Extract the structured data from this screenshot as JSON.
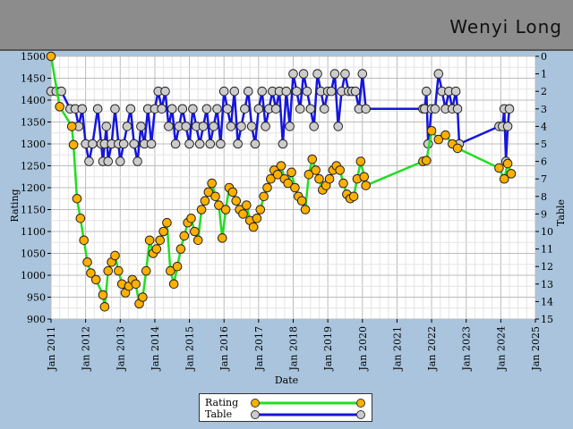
{
  "header": {
    "player_name": "Wenyi Long"
  },
  "legend": {
    "rating_label": "Rating",
    "table_label": "Table"
  },
  "chart_data": {
    "type": "line",
    "xlabel": "Date",
    "ylabel": "Rating",
    "y2label": "Table",
    "xlim": [
      2011.0,
      2025.0
    ],
    "ylim": [
      900,
      1500
    ],
    "y2lim": [
      0,
      15
    ],
    "y2_inverted": true,
    "grid": true,
    "legend_position": "bottom-center",
    "x_ticks": [
      "Jan 2011",
      "Jan 2012",
      "Jan 2013",
      "Jan 2014",
      "Jan 2015",
      "Jan 2016",
      "Jan 2017",
      "Jan 2018",
      "Jan 2019",
      "Jan 2020",
      "Jan 2021",
      "Jan 2022",
      "Jan 2023",
      "Jan 2024",
      "Jan 2025"
    ],
    "y_ticks": [
      900,
      950,
      1000,
      1050,
      1100,
      1150,
      1200,
      1250,
      1300,
      1350,
      1400,
      1450,
      1500
    ],
    "y2_ticks": [
      0,
      1,
      2,
      3,
      4,
      5,
      6,
      7,
      8,
      9,
      10,
      11,
      12,
      13,
      14,
      15
    ],
    "colors": {
      "rating_line": "#22dd22",
      "rating_marker": "#ffb000",
      "table_line": "#1515e0",
      "table_marker": "#cccccc"
    },
    "series": [
      {
        "name": "Rating",
        "x": [
          2011.0,
          2011.25,
          2011.6,
          2011.65,
          2011.75,
          2011.85,
          2011.95,
          2012.05,
          2012.15,
          2012.3,
          2012.5,
          2012.55,
          2012.65,
          2012.75,
          2012.85,
          2012.95,
          2013.05,
          2013.15,
          2013.25,
          2013.35,
          2013.45,
          2013.55,
          2013.65,
          2013.75,
          2013.85,
          2013.95,
          2014.05,
          2014.15,
          2014.25,
          2014.35,
          2014.45,
          2014.55,
          2014.65,
          2014.75,
          2014.85,
          2014.95,
          2015.05,
          2015.15,
          2015.25,
          2015.35,
          2015.45,
          2015.55,
          2015.65,
          2015.75,
          2015.85,
          2015.95,
          2016.05,
          2016.15,
          2016.25,
          2016.35,
          2016.45,
          2016.55,
          2016.65,
          2016.75,
          2016.85,
          2016.95,
          2017.05,
          2017.15,
          2017.25,
          2017.35,
          2017.45,
          2017.55,
          2017.65,
          2017.75,
          2017.85,
          2017.95,
          2018.05,
          2018.15,
          2018.25,
          2018.35,
          2018.45,
          2018.55,
          2018.65,
          2018.75,
          2018.85,
          2018.95,
          2019.05,
          2019.15,
          2019.25,
          2019.35,
          2019.45,
          2019.55,
          2019.65,
          2019.75,
          2019.85,
          2019.95,
          2020.05,
          2020.1,
          2021.75,
          2021.85,
          2022.0,
          2022.2,
          2022.4,
          2022.6,
          2022.75,
          2023.95,
          2024.1,
          2024.2,
          2024.3
        ],
        "values": [
          1500,
          1385,
          1340,
          1298,
          1175,
          1130,
          1080,
          1030,
          1005,
          990,
          955,
          928,
          1010,
          1030,
          1045,
          1010,
          980,
          960,
          975,
          990,
          980,
          935,
          950,
          1010,
          1080,
          1050,
          1060,
          1080,
          1100,
          1120,
          1010,
          980,
          1020,
          1060,
          1090,
          1120,
          1130,
          1100,
          1080,
          1150,
          1170,
          1190,
          1210,
          1180,
          1160,
          1085,
          1150,
          1200,
          1190,
          1170,
          1150,
          1140,
          1160,
          1125,
          1110,
          1130,
          1150,
          1180,
          1200,
          1220,
          1240,
          1230,
          1250,
          1220,
          1210,
          1235,
          1200,
          1180,
          1170,
          1150,
          1230,
          1265,
          1240,
          1220,
          1195,
          1205,
          1220,
          1240,
          1250,
          1240,
          1210,
          1185,
          1175,
          1180,
          1220,
          1260,
          1225,
          1205,
          1260,
          1262,
          1330,
          1310,
          1320,
          1300,
          1290,
          1245,
          1220,
          1255,
          1232
        ]
      },
      {
        "name": "Table",
        "x": [
          2011.0,
          2011.15,
          2011.3,
          2011.55,
          2011.7,
          2011.8,
          2011.9,
          2012.0,
          2012.1,
          2012.2,
          2012.35,
          2012.45,
          2012.5,
          2012.55,
          2012.6,
          2012.65,
          2012.75,
          2012.85,
          2012.95,
          2013.0,
          2013.1,
          2013.2,
          2013.3,
          2013.4,
          2013.5,
          2013.6,
          2013.7,
          2013.8,
          2013.9,
          2014.0,
          2014.1,
          2014.2,
          2014.3,
          2014.4,
          2014.5,
          2014.6,
          2014.7,
          2014.8,
          2014.9,
          2015.0,
          2015.1,
          2015.2,
          2015.3,
          2015.4,
          2015.5,
          2015.6,
          2015.7,
          2015.8,
          2015.9,
          2016.0,
          2016.1,
          2016.2,
          2016.3,
          2016.4,
          2016.5,
          2016.6,
          2016.7,
          2016.8,
          2016.9,
          2017.0,
          2017.1,
          2017.2,
          2017.3,
          2017.4,
          2017.5,
          2017.6,
          2017.7,
          2017.8,
          2017.9,
          2018.0,
          2018.1,
          2018.2,
          2018.3,
          2018.4,
          2018.5,
          2018.6,
          2018.7,
          2018.8,
          2018.9,
          2019.0,
          2019.1,
          2019.2,
          2019.3,
          2019.4,
          2019.5,
          2019.6,
          2019.7,
          2019.8,
          2019.9,
          2020.0,
          2020.1,
          2021.75,
          2021.8,
          2021.85,
          2021.9,
          2022.0,
          2022.1,
          2022.2,
          2022.3,
          2022.4,
          2022.5,
          2022.6,
          2022.7,
          2022.75,
          2022.8,
          2023.95,
          2024.05,
          2024.1,
          2024.15,
          2024.2,
          2024.25
        ],
        "values": [
          2,
          2,
          2,
          3,
          3,
          4,
          3,
          5,
          6,
          5,
          3,
          5,
          6,
          5,
          4,
          6,
          5,
          3,
          5,
          6,
          5,
          4,
          3,
          5,
          6,
          4,
          5,
          3,
          5,
          3,
          2,
          3,
          2,
          4,
          3,
          5,
          4,
          3,
          4,
          5,
          3,
          4,
          5,
          4,
          3,
          5,
          4,
          3,
          5,
          2,
          3,
          4,
          2,
          5,
          4,
          3,
          2,
          4,
          5,
          3,
          2,
          4,
          3,
          2,
          3,
          2,
          5,
          2,
          4,
          1,
          2,
          3,
          1,
          2,
          3,
          4,
          1,
          2,
          3,
          2,
          2,
          1,
          4,
          2,
          1,
          2,
          2,
          2,
          3,
          1,
          3,
          3,
          3,
          2,
          5,
          3,
          3,
          1,
          2,
          3,
          2,
          3,
          2,
          3,
          5,
          4,
          4,
          3,
          6,
          4,
          3
        ]
      }
    ]
  }
}
